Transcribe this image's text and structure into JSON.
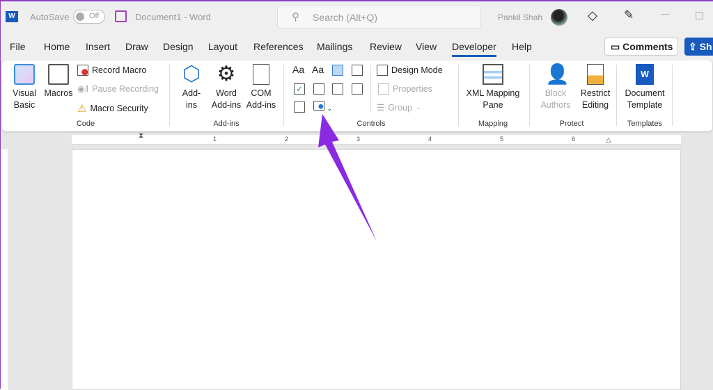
{
  "titlebar": {
    "autosave_label": "AutoSave",
    "autosave_state": "Off",
    "doc_title": "Document1  -  Word",
    "search_placeholder": "Search (Alt+Q)",
    "user_name": "Pankil Shah"
  },
  "tabs": [
    {
      "label": "File"
    },
    {
      "label": "Home"
    },
    {
      "label": "Insert"
    },
    {
      "label": "Draw"
    },
    {
      "label": "Design"
    },
    {
      "label": "Layout"
    },
    {
      "label": "References"
    },
    {
      "label": "Mailings"
    },
    {
      "label": "Review"
    },
    {
      "label": "View"
    },
    {
      "label": "Developer",
      "active": true
    },
    {
      "label": "Help"
    }
  ],
  "actions": {
    "comments": "Comments",
    "share": "Sh"
  },
  "ribbon": {
    "code": {
      "label": "Code",
      "visual_basic": "Visual Basic",
      "macros": "Macros",
      "record_macro": "Record Macro",
      "pause_recording": "Pause Recording",
      "macro_security": "Macro Security"
    },
    "addins": {
      "label": "Add-ins",
      "addins": "Add-ins",
      "word_addins": "Word Add-ins",
      "com_addins": "COM Add-ins"
    },
    "controls": {
      "label": "Controls",
      "rich_text": "Aa",
      "plain_text": "Aa",
      "design_mode": "Design Mode",
      "properties": "Properties",
      "group": "Group"
    },
    "mapping": {
      "label": "Mapping",
      "xml_mapping": "XML Mapping Pane"
    },
    "protect": {
      "label": "Protect",
      "block_authors": "Block Authors",
      "restrict_editing": "Restrict Editing"
    },
    "templates": {
      "label": "Templates",
      "document_template": "Document Template"
    }
  },
  "ruler": {
    "numbers": [
      "1",
      "2",
      "3",
      "4",
      "5",
      "6"
    ]
  },
  "colors": {
    "accent": "#185abd",
    "arrow": "#8a2be2"
  }
}
